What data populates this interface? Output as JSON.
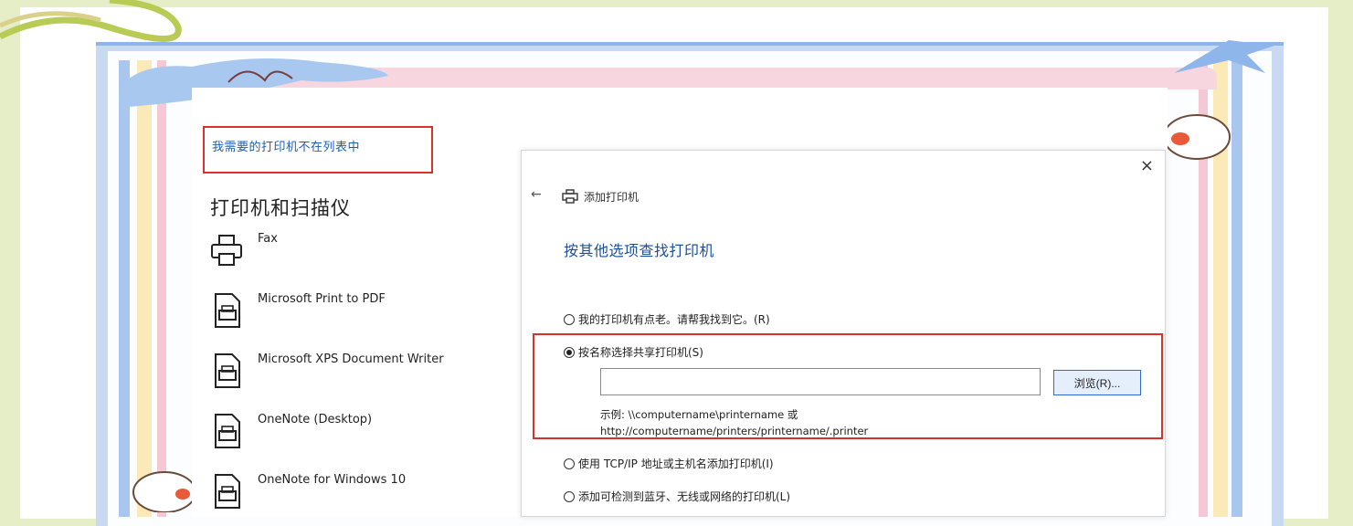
{
  "settings": {
    "missing_printer_link": "我需要的打印机不在列表中",
    "section_title": "打印机和扫描仪",
    "devices": [
      {
        "label": "Fax",
        "icon": "fax-icon"
      },
      {
        "label": "Microsoft Print to PDF",
        "icon": "printer-document-icon"
      },
      {
        "label": "Microsoft XPS Document Writer",
        "icon": "printer-document-icon"
      },
      {
        "label": "OneNote (Desktop)",
        "icon": "printer-document-icon"
      },
      {
        "label": "OneNote for Windows 10",
        "icon": "printer-document-icon"
      }
    ]
  },
  "dialog": {
    "close": "×",
    "back": "←",
    "header": "添加打印机",
    "heading": "按其他选项查找打印机",
    "options": [
      {
        "label": "我的打印机有点老。请帮我找到它。(R)",
        "checked": false
      },
      {
        "label": "按名称选择共享打印机(S)",
        "checked": true
      },
      {
        "label": "使用 TCP/IP 地址或主机名添加打印机(I)",
        "checked": false
      },
      {
        "label": "添加可检测到蓝牙、无线或网络的打印机(L)",
        "checked": false
      }
    ],
    "share_input_value": "",
    "browse_label": "浏览(R)...",
    "example_line1": "示例: \\\\computername\\printername 或",
    "example_line2": "http://computername/printers/printername/.printer"
  },
  "colors": {
    "highlight": "#d8322f",
    "link": "#1a5fb4",
    "heading": "#1a4f9c"
  }
}
